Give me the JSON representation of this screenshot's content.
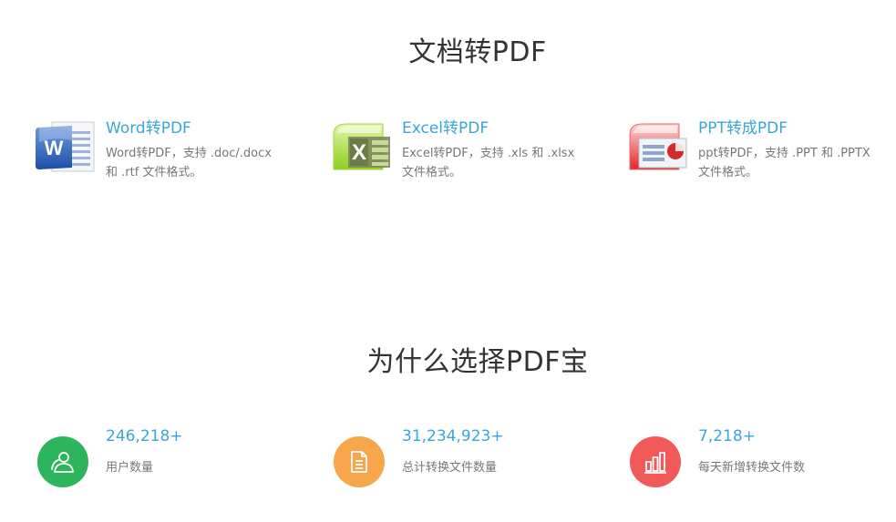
{
  "sections": {
    "convert_title": "文档转PDF",
    "why_title": "为什么选择PDF宝"
  },
  "features": [
    {
      "title": "Word转PDF",
      "desc_line1": "Word转PDF，支持 .doc/.docx",
      "desc_line2": "和 .rtf 文件格式。",
      "icon": "word-doc-icon"
    },
    {
      "title": "Excel转PDF",
      "desc_line1": "Excel转PDF，支持 .xls 和 .xlsx",
      "desc_line2": "文件格式。",
      "icon": "excel-sheet-icon"
    },
    {
      "title": "PPT转成PDF",
      "desc_line1": "ppt转PDF，支持 .PPT 和 .PPTX",
      "desc_line2": "文件格式。",
      "icon": "ppt-slide-icon"
    }
  ],
  "stats": [
    {
      "value": "246,218+",
      "label": "用户数量",
      "icon": "user-icon",
      "color": "#2db55d"
    },
    {
      "value": "31,234,923+",
      "label": "总计转换文件数量",
      "icon": "document-icon",
      "color": "#f7a64b"
    },
    {
      "value": "7,218+",
      "label": "每天新增转换文件数",
      "icon": "bar-chart-icon",
      "color": "#f25a5a"
    }
  ],
  "colors": {
    "accent": "#3aa6d8",
    "text": "#333333",
    "muted": "#777777"
  }
}
